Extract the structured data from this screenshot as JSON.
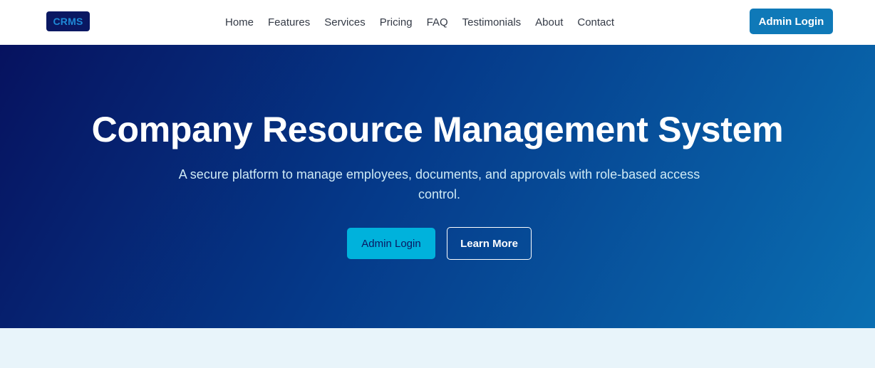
{
  "navbar": {
    "logo_text": "CRMS",
    "links": [
      "Home",
      "Features",
      "Services",
      "Pricing",
      "FAQ",
      "Testimonials",
      "About",
      "Contact"
    ],
    "cta_label": "Admin Login"
  },
  "hero": {
    "title": "Company Resource Management System",
    "subtitle": "A secure platform to manage employees, documents, and approvals with role-based access control.",
    "primary_button": "Admin Login",
    "secondary_button": "Learn More"
  },
  "colors": {
    "logo_bg": "#0a1862",
    "logo_text": "#1f8ad6",
    "nav_cta_bg": "#0f79b8",
    "hero_gradient_start": "#06125f",
    "hero_gradient_end": "#0a6fb2",
    "primary_button_bg": "#00b2dc",
    "section_bg": "#e8f4fa"
  }
}
